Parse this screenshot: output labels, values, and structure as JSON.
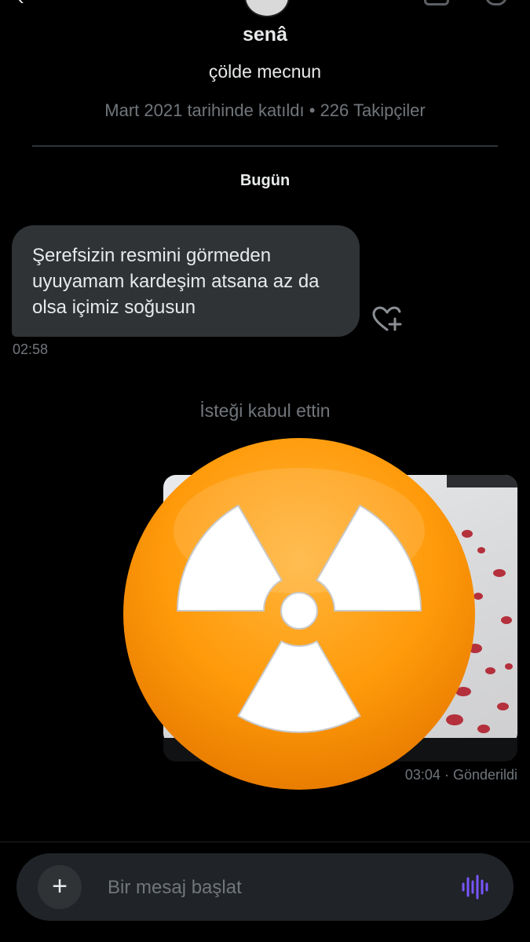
{
  "profile": {
    "name": "senâ",
    "bio": "çölde mecnun",
    "meta": "Mart 2021 tarihinde katıldı • 226 Takipçiler"
  },
  "conversation": {
    "day_label": "Bugün",
    "received": {
      "text": "Şerefsizin resmini görmeden uyuyamam kardeşim atsana az da olsa içimiz soğusun",
      "time": "02:58"
    },
    "system_note": "İsteği kabul ettin",
    "sent": {
      "time": "03:04",
      "status": "· Gönderildi"
    }
  },
  "composer": {
    "placeholder": "Bir mesaj başlat",
    "add_label": "+"
  },
  "icons": {
    "back": "back-arrow-icon",
    "reaction": "heart-plus-icon",
    "overlay": "radioactive-emoji-icon",
    "voice": "voice-wave-icon"
  },
  "colors": {
    "background": "#000000",
    "bubble": "#2f3336",
    "muted_text": "#71767b",
    "accent_voice": "#7856ff",
    "emoji_orange": "#ff9500"
  }
}
